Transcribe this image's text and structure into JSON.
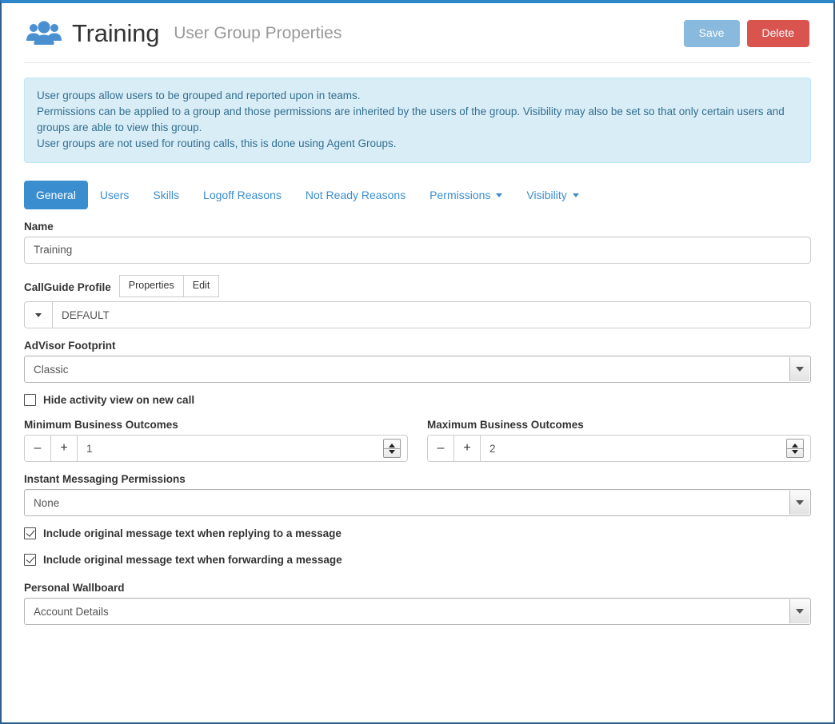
{
  "header": {
    "icon": "users-group-icon",
    "title": "Training",
    "subtitle": "User Group Properties",
    "save_label": "Save",
    "delete_label": "Delete",
    "save_color": "#89b9dd",
    "delete_color": "#d9534f"
  },
  "alert": {
    "line1": "User groups allow users to be grouped and reported upon in teams.",
    "line2": "Permissions can be applied to a group and those permissions are inherited by the users of the group. Visibility may also be set so that only certain users and groups are able to view this group.",
    "line3": "User groups are not used for routing calls, this is done using Agent Groups.",
    "bg_color": "#d9edf7",
    "border_color": "#bce8f1",
    "text_color": "#31708f"
  },
  "tabs": {
    "active_color": "#3a8ed0",
    "items": [
      {
        "label": "General",
        "active": true,
        "caret": false
      },
      {
        "label": "Users",
        "active": false,
        "caret": false
      },
      {
        "label": "Skills",
        "active": false,
        "caret": false
      },
      {
        "label": "Logoff Reasons",
        "active": false,
        "caret": false
      },
      {
        "label": "Not Ready Reasons",
        "active": false,
        "caret": false
      },
      {
        "label": "Permissions",
        "active": false,
        "caret": true
      },
      {
        "label": "Visibility",
        "active": false,
        "caret": true
      }
    ]
  },
  "form": {
    "name": {
      "label": "Name",
      "value": "Training"
    },
    "callguide": {
      "label": "CallGuide Profile",
      "properties_label": "Properties",
      "edit_label": "Edit",
      "value": "DEFAULT"
    },
    "advisor_footprint": {
      "label": "AdVisor Footprint",
      "value": "Classic"
    },
    "hide_activity": {
      "label": "Hide activity view on new call",
      "checked": false
    },
    "min_outcomes": {
      "label": "Minimum Business Outcomes",
      "minus": "–",
      "plus": "+",
      "value": "1"
    },
    "max_outcomes": {
      "label": "Maximum Business Outcomes",
      "minus": "–",
      "plus": "+",
      "value": "2"
    },
    "im_permissions": {
      "label": "Instant Messaging Permissions",
      "value": "None"
    },
    "include_reply": {
      "label": "Include original message text when replying to a message",
      "checked": true
    },
    "include_forward": {
      "label": "Include original message text when forwarding a message",
      "checked": true
    },
    "personal_wallboard": {
      "label": "Personal Wallboard",
      "value": "Account Details"
    }
  }
}
